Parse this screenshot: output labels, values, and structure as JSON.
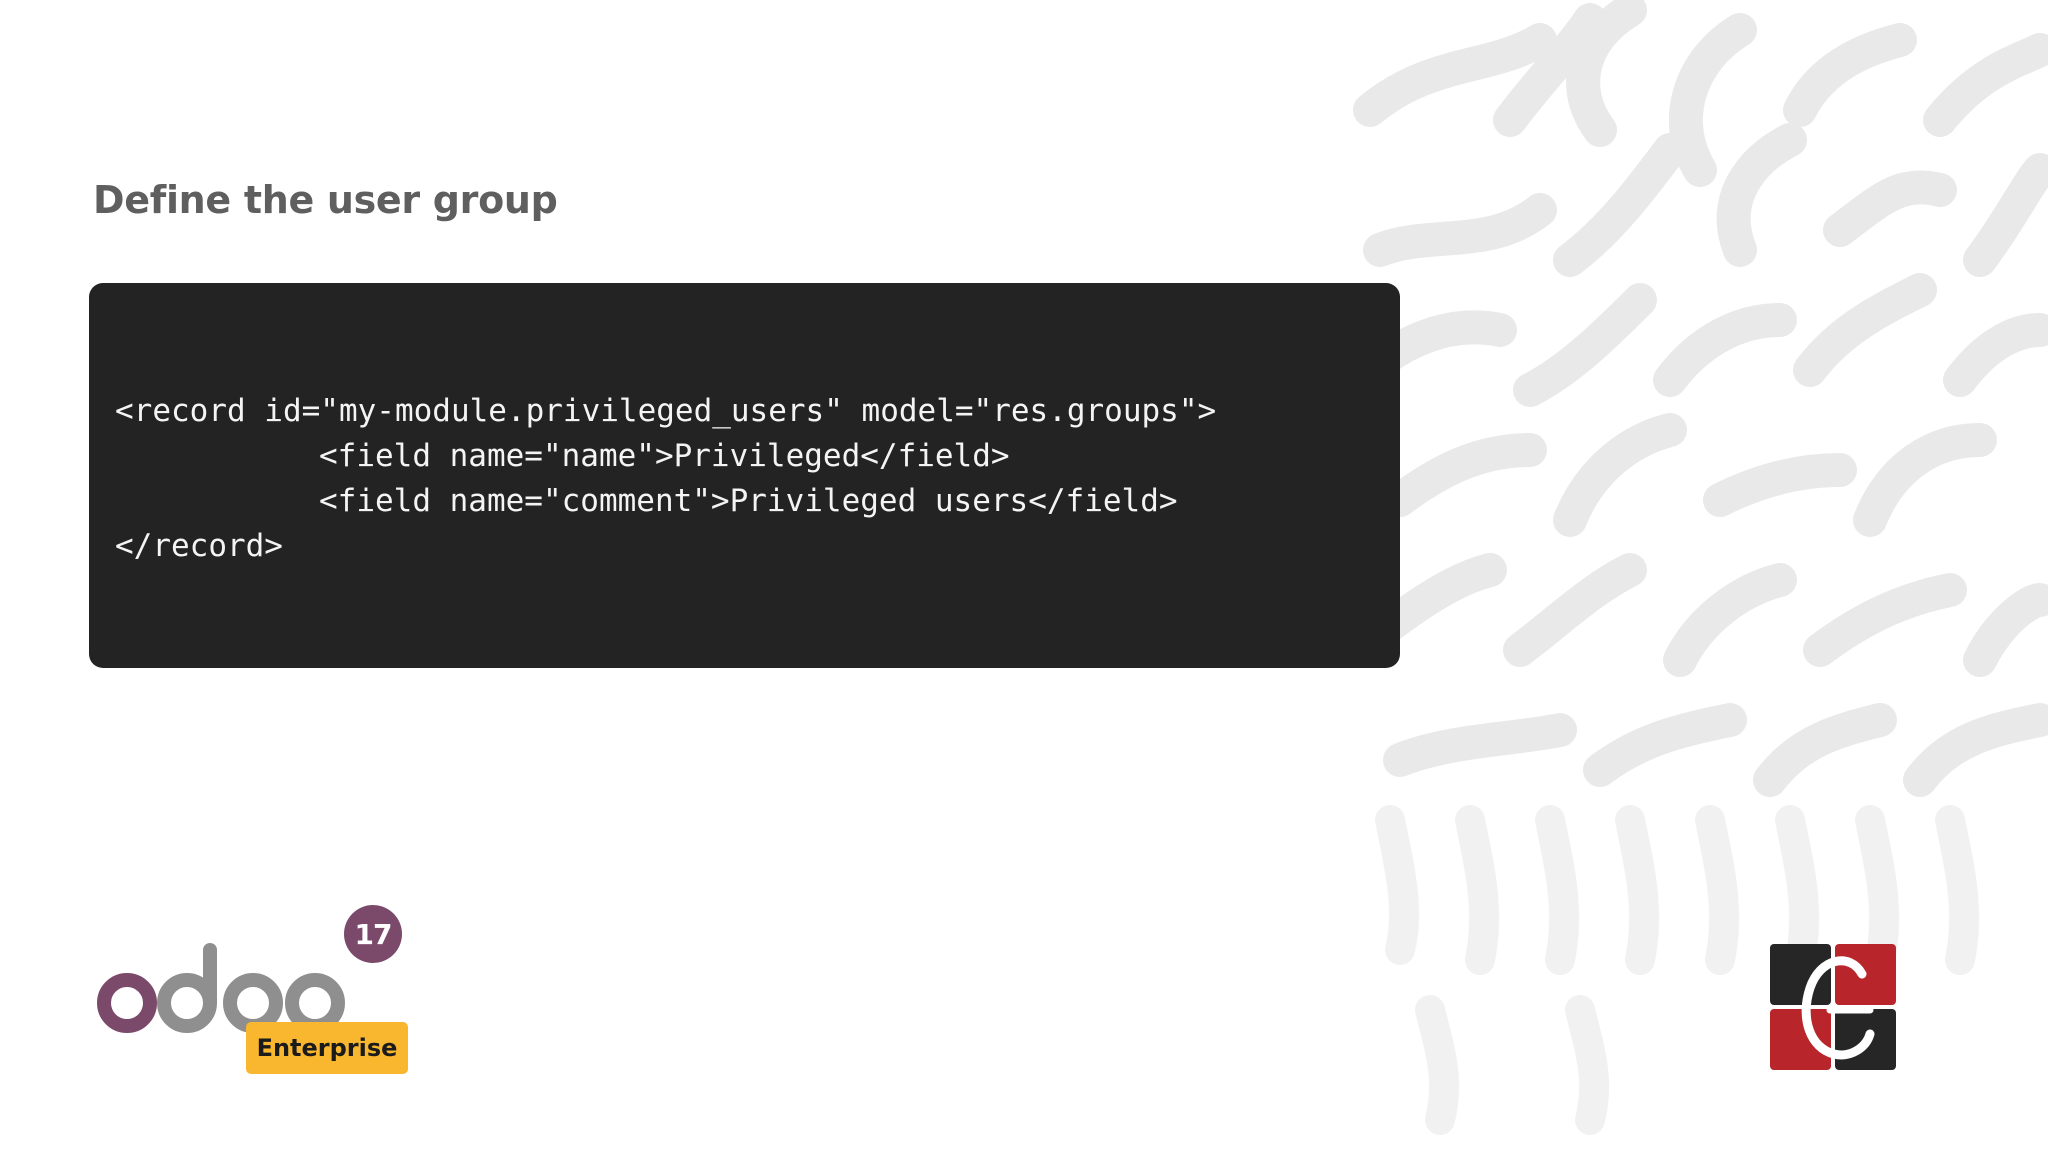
{
  "slide": {
    "title": "Define the user group"
  },
  "code": {
    "lines": [
      "<record id=\"my-module.privileged_users\" model=\"res.groups\">",
      "<field name=\"name\">Privileged</field>",
      "<field name=\"comment\">Privileged users</field>",
      "</record>"
    ]
  },
  "branding": {
    "product_word": "odoo",
    "version": "17",
    "edition": "Enterprise",
    "icons": [
      "odoo-logo-icon",
      "company-logo-icon"
    ]
  },
  "colors": {
    "title": "#5f5f5f",
    "code_bg": "#232323",
    "code_text": "#f4f4f4",
    "odoo_purple": "#7b4a6b",
    "odoo_gray": "#8f8f8f",
    "enterprise_badge": "#f9b72f",
    "logo_dark": "#262626",
    "logo_red": "#b8262b",
    "pattern": "#e9e9e9"
  }
}
